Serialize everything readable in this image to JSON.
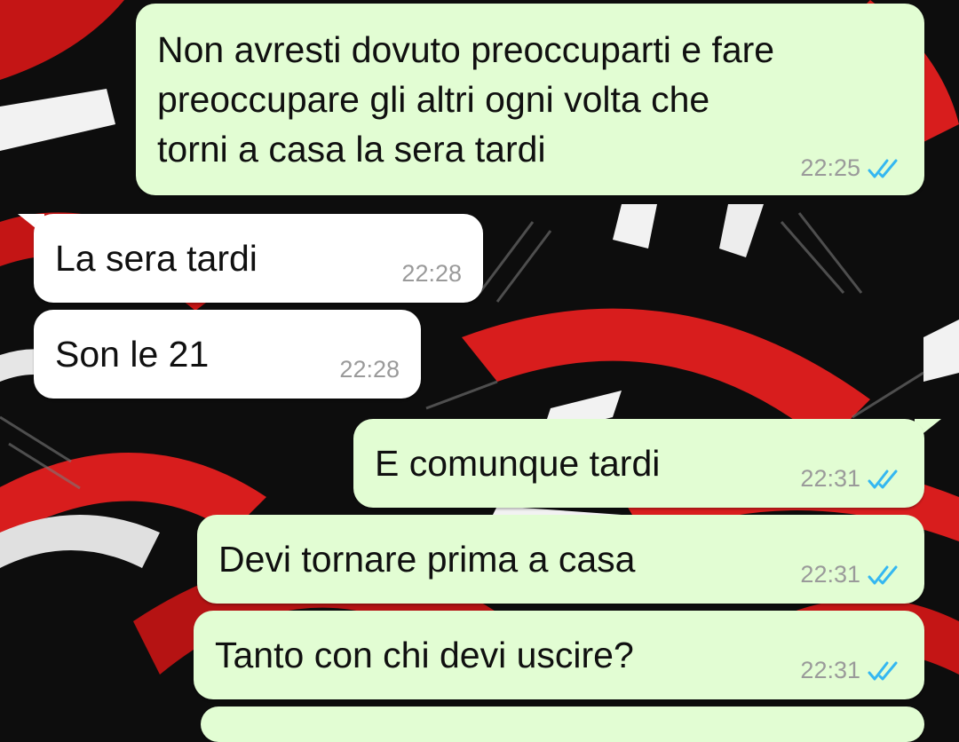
{
  "colors": {
    "outgoing_bubble": "#e2fdd3",
    "incoming_bubble": "#ffffff",
    "read_ticks": "#34b7f1",
    "timestamp": "#9a9a9a",
    "wallpaper_primary": "#0d0d0d",
    "wallpaper_accent_red": "#d81d1d",
    "wallpaper_accent_white": "#f2f2f2"
  },
  "messages": [
    {
      "direction": "outgoing",
      "lines": [
        "Non avresti dovuto preoccuparti e fare",
        "preoccupare gli altri ogni volta che",
        "torni a casa la sera tardi"
      ],
      "time": "22:25",
      "status_icon": "double-check-icon"
    },
    {
      "direction": "incoming",
      "lines": [
        "La sera tardi"
      ],
      "time": "22:28"
    },
    {
      "direction": "incoming",
      "lines": [
        "Son le 21"
      ],
      "time": "22:28"
    },
    {
      "direction": "outgoing",
      "lines": [
        "E comunque tardi"
      ],
      "time": "22:31",
      "status_icon": "double-check-icon"
    },
    {
      "direction": "outgoing",
      "lines": [
        "Devi tornare prima a casa"
      ],
      "time": "22:31",
      "status_icon": "double-check-icon"
    },
    {
      "direction": "outgoing",
      "lines": [
        "Tanto con chi devi uscire?"
      ],
      "time": "22:31",
      "status_icon": "double-check-icon"
    }
  ]
}
